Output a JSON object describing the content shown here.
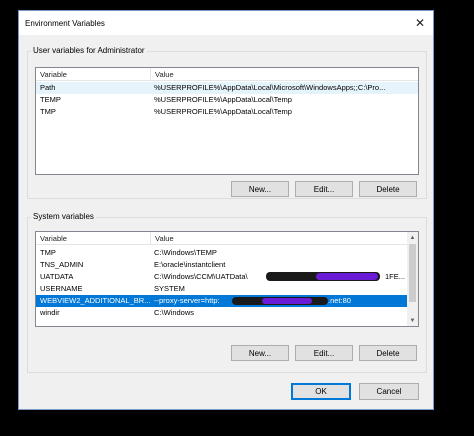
{
  "window": {
    "title": "Environment Variables",
    "close_glyph": "✕"
  },
  "user_vars": {
    "group_label": "User variables for Administrator",
    "columns": [
      "Variable",
      "Value"
    ],
    "rows": [
      {
        "name": "Path",
        "value": "%USERPROFILE%\\AppData\\Local\\Microsoft\\WindowsApps;;C:\\Pro..."
      },
      {
        "name": "TEMP",
        "value": "%USERPROFILE%\\AppData\\Local\\Temp"
      },
      {
        "name": "TMP",
        "value": "%USERPROFILE%\\AppData\\Local\\Temp"
      }
    ],
    "buttons": {
      "new": "New...",
      "edit": "Edit...",
      "delete": "Delete"
    }
  },
  "system_vars": {
    "group_label": "System variables",
    "columns": [
      "Variable",
      "Value"
    ],
    "rows": [
      {
        "name": "TMP",
        "value": "C:\\Windows\\TEMP"
      },
      {
        "name": "TNS_ADMIN",
        "value": "E:\\oracle\\instantclient"
      },
      {
        "name": "UATDATA",
        "value": "C:\\Windows\\CCM\\UATData\\",
        "value_suffix": "1FE..."
      },
      {
        "name": "USERNAME",
        "value": "SYSTEM"
      },
      {
        "name": "WEBVIEW2_ADDITIONAL_BR...",
        "value": "--proxy-server=http:",
        "value_suffix": ".net:80"
      },
      {
        "name": "windir",
        "value": "C:\\Windows"
      }
    ],
    "selected_index": 4,
    "buttons": {
      "new": "New...",
      "edit": "Edit...",
      "delete": "Delete"
    }
  },
  "footer": {
    "ok": "OK",
    "cancel": "Cancel"
  },
  "colors": {
    "selection": "#0078d7",
    "redaction_dark": "#1a1a1a",
    "redaction_purple": "#6a1bd6"
  },
  "icons": {
    "scroll_up": "up-arrow-icon",
    "scroll_down": "down-arrow-icon"
  }
}
